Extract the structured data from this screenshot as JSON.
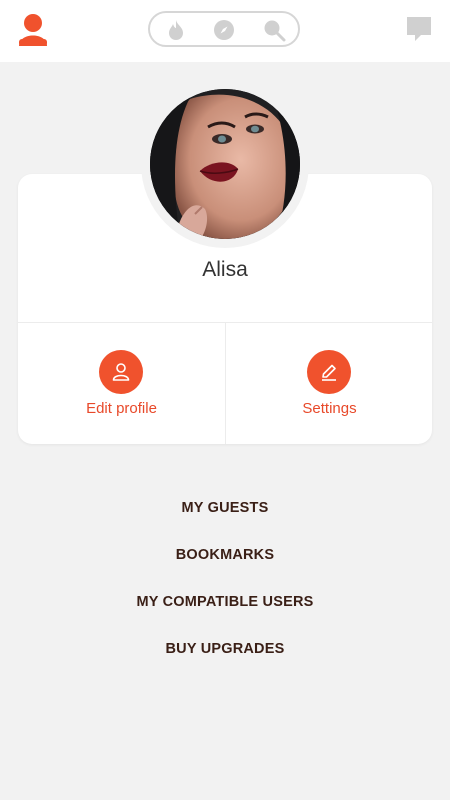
{
  "topbar": {
    "icons": [
      "user-silhouette-icon",
      "flame-icon",
      "compass-icon",
      "search-icon",
      "chat-bubble-icon"
    ],
    "accent_color": "#f0522d",
    "inactive_color": "#d0d0d0"
  },
  "profile": {
    "name": "Alisa"
  },
  "actions": {
    "edit_profile_label": "Edit profile",
    "settings_label": "Settings"
  },
  "menu": {
    "items": [
      "MY GUESTS",
      "BOOKMARKS",
      "MY COMPATIBLE USERS",
      "BUY UPGRADES"
    ]
  }
}
